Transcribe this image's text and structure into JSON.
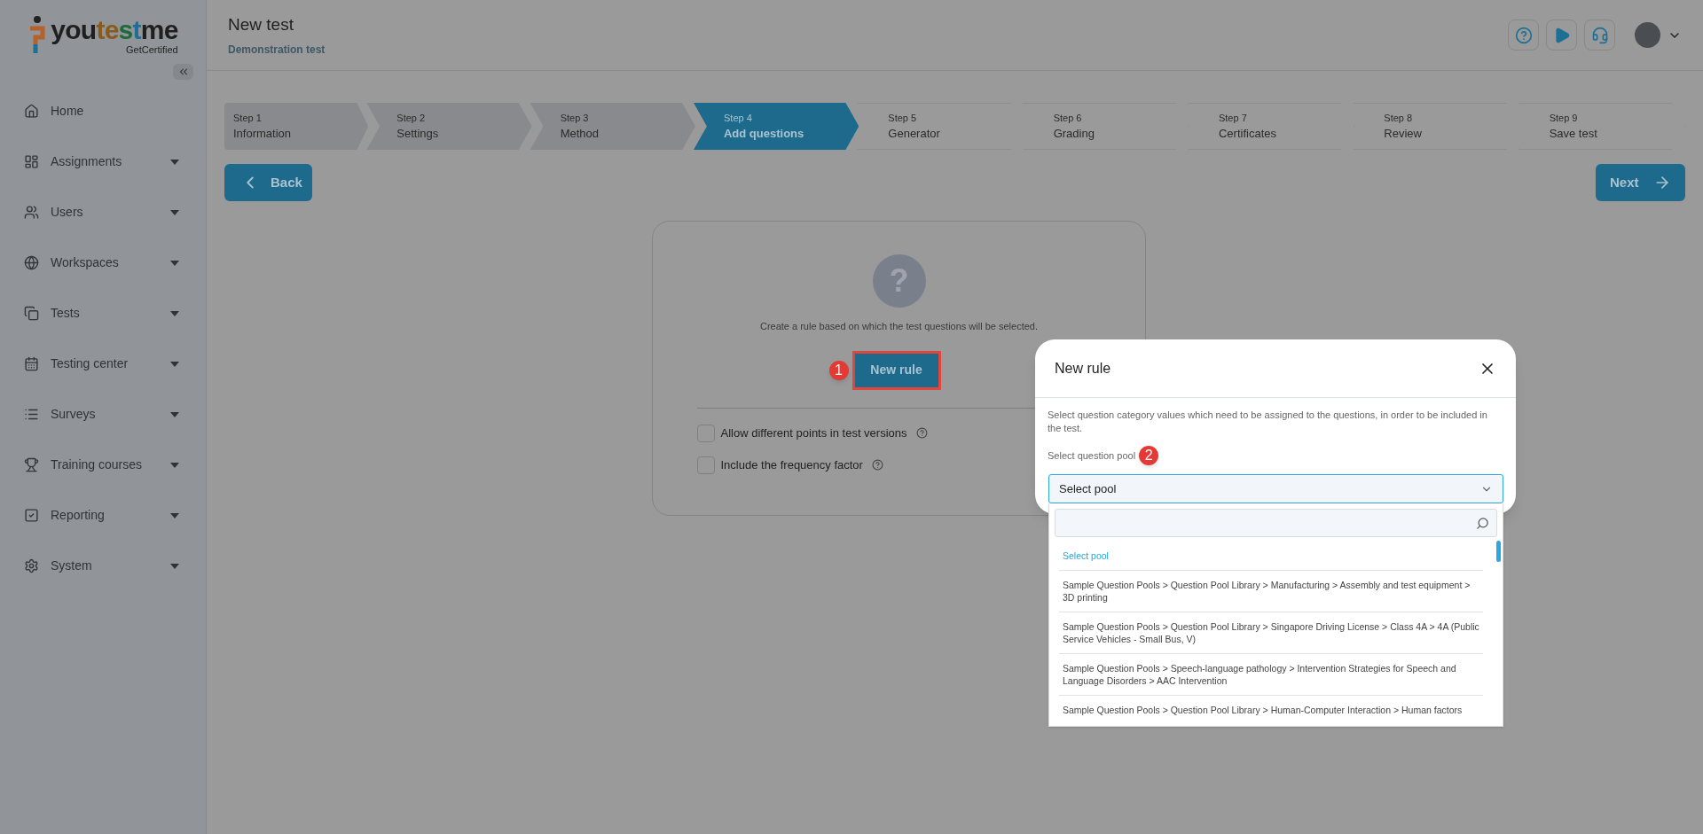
{
  "brand": {
    "name_parts": [
      "you",
      "te",
      "s",
      "t",
      "me"
    ],
    "tagline": "GetCertified"
  },
  "sidebar": {
    "items": [
      {
        "label": "Home",
        "has_submenu": false
      },
      {
        "label": "Assignments",
        "has_submenu": true
      },
      {
        "label": "Users",
        "has_submenu": true
      },
      {
        "label": "Workspaces",
        "has_submenu": true
      },
      {
        "label": "Tests",
        "has_submenu": true
      },
      {
        "label": "Testing center",
        "has_submenu": true
      },
      {
        "label": "Surveys",
        "has_submenu": true
      },
      {
        "label": "Training courses",
        "has_submenu": true
      },
      {
        "label": "Reporting",
        "has_submenu": true
      },
      {
        "label": "System",
        "has_submenu": true
      }
    ]
  },
  "header": {
    "title": "New test",
    "subtitle": "Demonstration test"
  },
  "steps": [
    {
      "step": "Step 1",
      "title": "Information",
      "completed": true,
      "selected": false
    },
    {
      "step": "Step 2",
      "title": "Settings",
      "completed": true,
      "selected": false
    },
    {
      "step": "Step 3",
      "title": "Method",
      "completed": true,
      "selected": false
    },
    {
      "step": "Step 4",
      "title": "Add questions",
      "completed": false,
      "selected": true
    },
    {
      "step": "Step 5",
      "title": "Generator",
      "completed": false,
      "selected": false
    },
    {
      "step": "Step 6",
      "title": "Grading",
      "completed": false,
      "selected": false
    },
    {
      "step": "Step 7",
      "title": "Certificates",
      "completed": false,
      "selected": false
    },
    {
      "step": "Step 8",
      "title": "Review",
      "completed": false,
      "selected": false
    },
    {
      "step": "Step 9",
      "title": "Save test",
      "completed": false,
      "selected": false
    }
  ],
  "back_button": "Back",
  "next_button": "Next",
  "rules_card": {
    "icon_glyph": "?",
    "hint": "Create a rule based on which the test questions will be selected.",
    "new_rule_button": "New rule",
    "highlighted": true,
    "marker": "1",
    "options": [
      {
        "label": "Allow different points in test versions",
        "checked": false
      },
      {
        "label": "Include the frequency factor",
        "checked": false
      }
    ]
  },
  "dialog": {
    "title": "New rule",
    "description": "Select question category values which need to be assigned to the questions, in order to be included in the test.",
    "pool_label": "Select question pool",
    "marker": "2",
    "pool_value": "Select pool",
    "options": [
      {
        "label": "Select pool",
        "selected": true
      },
      {
        "label": "Sample Question Pools > Question Pool Library > Manufacturing  > Assembly and test equipment > 3D printing",
        "selected": false
      },
      {
        "label": "Sample Question Pools > Question Pool Library > Singapore Driving License  > Class 4A > 4A (Public Service Vehicles - Small Bus, V)",
        "selected": false
      },
      {
        "label": "Sample Question Pools > Speech-language pathology > Intervention Strategies for Speech and Language Disorders > AAC Intervention",
        "selected": false
      },
      {
        "label": "Sample Question Pools > Question Pool Library > Human-Computer Interaction > Human factors",
        "selected": false
      }
    ]
  }
}
